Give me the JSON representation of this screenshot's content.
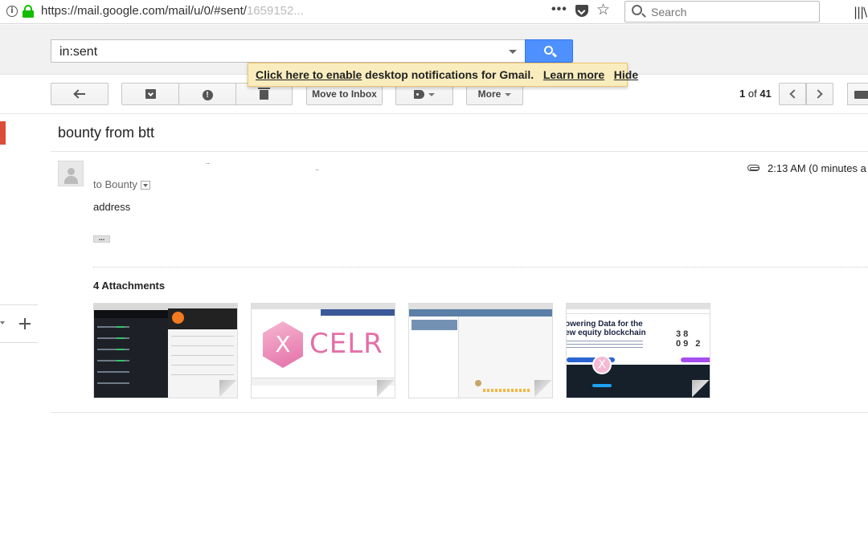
{
  "browser": {
    "url_main": "https://mail.google.com/mail/u/0/#sent/",
    "url_faded": "1659152...",
    "search_placeholder": "Search"
  },
  "gmail": {
    "search_value": "in:sent",
    "notification": {
      "enable_link": "Click here to enable",
      "text": "desktop notifications for Gmail.",
      "learn_more": "Learn more",
      "hide": "Hide"
    },
    "toolbar": {
      "move_to_inbox": "Move to Inbox",
      "more": "More",
      "spam_glyph": "!"
    },
    "pager": {
      "current": "1",
      "of_label": "of",
      "total": "41"
    }
  },
  "message": {
    "subject": "bounty from btt",
    "sender_redacted": "..",
    "sender_redacted_2": "..",
    "to_label": "to Bounty",
    "time": "2:13 AM (0 minutes a",
    "body": "address",
    "expand_dots": "...",
    "attachments_title": "4 Attachments",
    "attachments": [
      {
        "name": "attachment-1",
        "caption": ""
      },
      {
        "name": "attachment-2",
        "hex_letter": "X",
        "brand": "CELR"
      },
      {
        "name": "attachment-3",
        "caption": ""
      },
      {
        "name": "attachment-4",
        "headline": "owering Data for the ew equity blockchain",
        "countdown": "38 09 2",
        "logo_letter": "X"
      }
    ]
  },
  "icons": [
    "info-icon",
    "lock-icon",
    "more-dots-icon",
    "pocket-icon",
    "star-icon",
    "search-icon",
    "library-icon",
    "reply-arrow-icon",
    "archive-icon",
    "spam-icon",
    "trash-icon",
    "label-icon",
    "chevron-left-icon",
    "chevron-right-icon",
    "keyboard-icon",
    "avatar-icon",
    "paperclip-icon",
    "plus-icon"
  ],
  "colors": {
    "accent_blue": "#4d90fe",
    "notify_bg": "#f9edbe",
    "compose_red": "#dd4b39",
    "secure_green": "#12bc00"
  }
}
